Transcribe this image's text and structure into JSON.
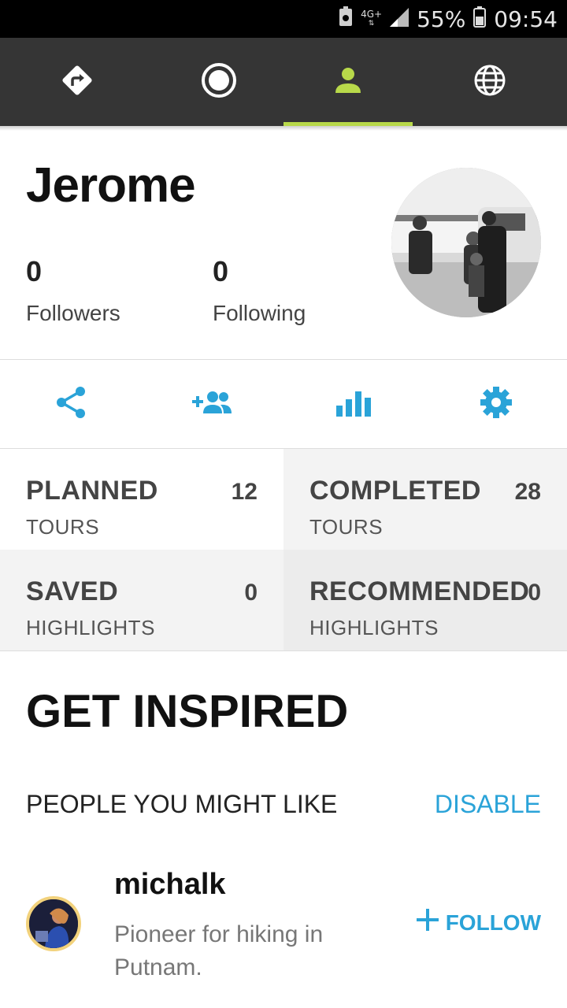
{
  "status_bar": {
    "network": "4G+",
    "battery": "55%",
    "time": "09:54"
  },
  "nav": {
    "tabs": [
      {
        "icon": "directions-icon",
        "active": false
      },
      {
        "icon": "record-icon",
        "active": false
      },
      {
        "icon": "profile-icon",
        "active": true
      },
      {
        "icon": "globe-icon",
        "active": false
      }
    ],
    "accent": "#b8d94a"
  },
  "profile": {
    "name": "Jerome",
    "followers_count": "0",
    "followers_label": "Followers",
    "following_count": "0",
    "following_label": "Following"
  },
  "actions": [
    {
      "icon": "share-icon"
    },
    {
      "icon": "add-friends-icon"
    },
    {
      "icon": "statistics-icon"
    },
    {
      "icon": "settings-icon"
    }
  ],
  "stats": {
    "planned": {
      "title": "PLANNED",
      "count": "12",
      "sub": "TOURS"
    },
    "completed": {
      "title": "COMPLETED",
      "count": "28",
      "sub": "TOURS"
    },
    "saved": {
      "title": "SAVED",
      "count": "0",
      "sub": "HIGHLIGHTS"
    },
    "recommended": {
      "title": "RECOMMENDED",
      "count": "0",
      "sub": "HIGHLIGHTS"
    }
  },
  "inspired": {
    "title": "GET INSPIRED",
    "section_label": "PEOPLE YOU MIGHT LIKE",
    "disable_label": "DISABLE",
    "suggestion": {
      "name": "michalk",
      "bio": "Pioneer for hiking in Putnam.",
      "follow_label": "FOLLOW"
    }
  },
  "colors": {
    "link_blue": "#2aa3d8",
    "nav_bg": "#353535"
  }
}
